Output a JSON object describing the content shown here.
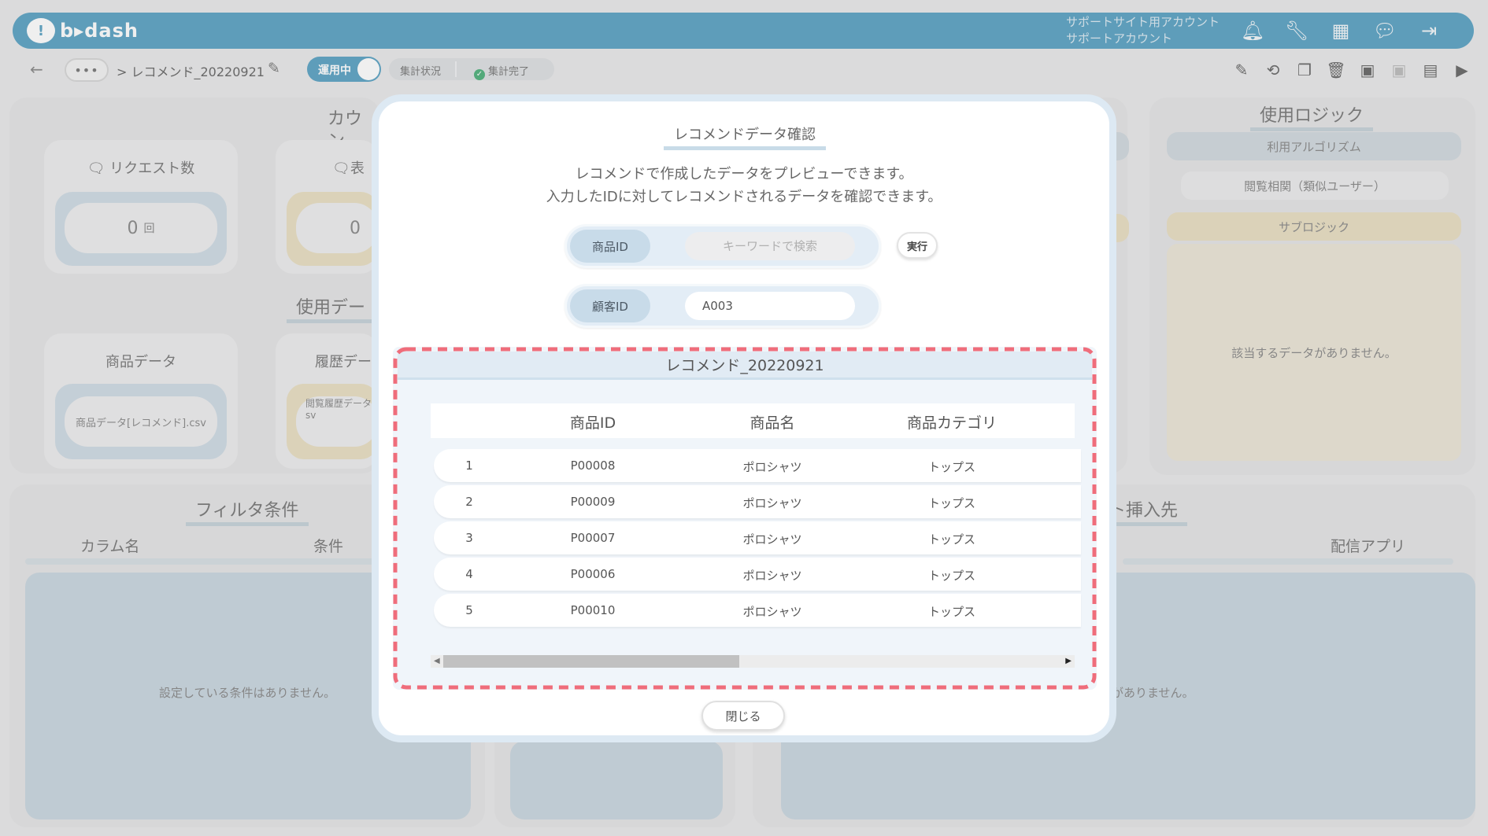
{
  "app": {
    "logo_text": "b▸dash"
  },
  "account": {
    "line1": "サポートサイト用アカウント",
    "line2": "サポートアカウント"
  },
  "header_icons": [
    "bell-icon",
    "wrench-icon",
    "grid-icon",
    "chat-icon",
    "logout-icon"
  ],
  "toolbar": {
    "dots": "•••",
    "breadcrumb": "> レコメンド_20220921",
    "toggle_label": "運用中",
    "status_a": "集計状況",
    "status_b": "集計完了"
  },
  "panels": {
    "count": {
      "title": "カウン",
      "card1_title": "リクエスト数",
      "card1_value": "0",
      "card1_unit": "回",
      "card2_title": "表",
      "card2_value": "0"
    },
    "data": {
      "title": "使用デー",
      "card1_title": "商品データ",
      "card1_file": "商品データ[レコメンド].csv",
      "card2_title": "履歴デー",
      "card2_file_line1": "閲覧履歴データ",
      "card2_file_line2": "sv"
    },
    "logic": {
      "title": "使用ロジック",
      "algo_label": "利用アルゴリズム",
      "algo_value": "閲覧相関（類似ユーザー）",
      "sublogic_label": "サブロジック",
      "empty_text": "該当するデータがありません。"
    },
    "filter": {
      "title": "フィルタ条件",
      "col1": "カラム名",
      "col2": "条件",
      "empty_text": "設定している条件はありません。"
    },
    "insert": {
      "title": "ト挿入先",
      "col": "配信アプリ",
      "empty_text": "がありません。"
    }
  },
  "modal": {
    "title": "レコメンドデータ確認",
    "desc_line1": "レコメンドで作成したデータをプレビューできます。",
    "desc_line2": "入力したIDに対してレコメンドされるデータを確認できます。",
    "field1_label": "商品ID",
    "field1_placeholder": "キーワードで検索",
    "exec_label": "実行",
    "field2_label": "顧客ID",
    "field2_value": "A003",
    "result_title": "レコメンド_20220921",
    "columns": [
      "商品ID",
      "商品名",
      "商品カテゴリ"
    ],
    "rows": [
      {
        "no": "1",
        "id": "P00008",
        "name": "ポロシャツ",
        "category": "トップス"
      },
      {
        "no": "2",
        "id": "P00009",
        "name": "ポロシャツ",
        "category": "トップス"
      },
      {
        "no": "3",
        "id": "P00007",
        "name": "ポロシャツ",
        "category": "トップス"
      },
      {
        "no": "4",
        "id": "P00006",
        "name": "ポロシャツ",
        "category": "トップス"
      },
      {
        "no": "5",
        "id": "P00010",
        "name": "ポロシャツ",
        "category": "トップス"
      }
    ],
    "close_label": "閉じる"
  },
  "colors": {
    "header": "#5aa2c3",
    "highlight_dash": "#ef6d7b",
    "status_ok": "#4eb07a"
  }
}
